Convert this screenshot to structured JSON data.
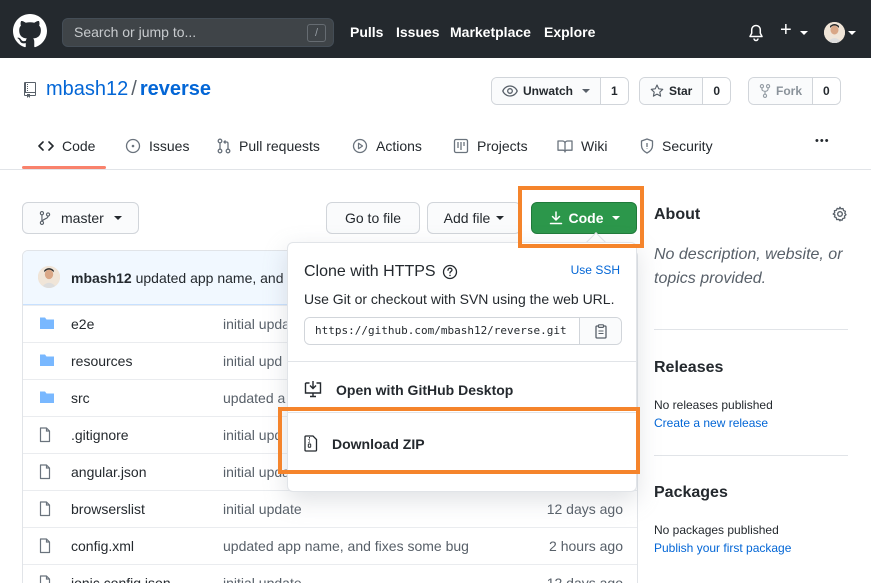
{
  "header": {
    "search_placeholder": "Search or jump to...",
    "search_shortcut": "/",
    "nav": [
      "Pulls",
      "Issues",
      "Marketplace",
      "Explore"
    ],
    "new_label": "+"
  },
  "repo": {
    "owner": "mbash12",
    "separator": "/",
    "name": "reverse",
    "watch_label": "Unwatch",
    "watch_count": "1",
    "star_label": "Star",
    "star_count": "0",
    "fork_label": "Fork",
    "fork_count": "0"
  },
  "tabs": [
    "Code",
    "Issues",
    "Pull requests",
    "Actions",
    "Projects",
    "Wiki",
    "Security"
  ],
  "tabs_more": "•••",
  "toolbar": {
    "branch": "master",
    "go_to_file": "Go to file",
    "add_file": "Add file",
    "code": "Code"
  },
  "commit": {
    "author": "mbash12",
    "message": "updated app name, and f"
  },
  "files": [
    {
      "name": "e2e",
      "type": "dir",
      "message": "initial upda",
      "age": ""
    },
    {
      "name": "resources",
      "type": "dir",
      "message": "initial upd",
      "age": ""
    },
    {
      "name": "src",
      "type": "dir",
      "message": "updated a",
      "age": ""
    },
    {
      "name": ".gitignore",
      "type": "file",
      "message": "initial upd",
      "age": ""
    },
    {
      "name": "angular.json",
      "type": "file",
      "message": "initial update",
      "age": "12 days ago"
    },
    {
      "name": "browserslist",
      "type": "file",
      "message": "initial update",
      "age": "12 days ago"
    },
    {
      "name": "config.xml",
      "type": "file",
      "message": "updated app name, and fixes some bug",
      "age": "2 hours ago"
    },
    {
      "name": "ionic.config.json",
      "type": "file",
      "message": "initial update",
      "age": "12 days ago"
    }
  ],
  "sidebar": {
    "about_title": "About",
    "about_desc": "No description, website, or topics provided.",
    "releases_title": "Releases",
    "releases_none": "No releases published",
    "releases_link": "Create a new release",
    "packages_title": "Packages",
    "packages_none": "No packages published",
    "packages_link": "Publish your first package"
  },
  "dropdown": {
    "title": "Clone with HTTPS",
    "use_ssh": "Use SSH",
    "subtitle": "Use Git or checkout with SVN using the web URL.",
    "url": "https://github.com/mbash12/reverse.git",
    "desktop": "Open with GitHub Desktop",
    "zip": "Download ZIP"
  },
  "colors": {
    "header_bg": "#24292e",
    "link": "#0366d6",
    "green_button": "#2c974b",
    "highlight": "#f5842b",
    "tab_underline": "#f9826c",
    "folder": "#79b8ff"
  }
}
